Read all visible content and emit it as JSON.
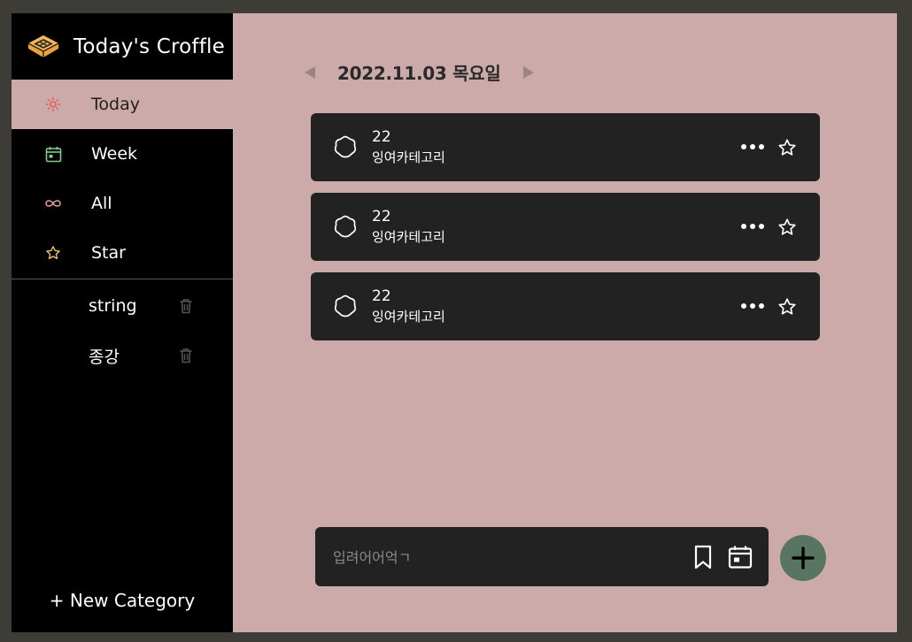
{
  "brand": {
    "title": "Today's Croffle",
    "logo_icon": "croffle-icon"
  },
  "nav": [
    {
      "label": "Today",
      "icon": "sun-icon",
      "color": "#e5534b",
      "active": true
    },
    {
      "label": "Week",
      "icon": "calendar-week-icon",
      "color": "#7ecf8a",
      "active": false
    },
    {
      "label": "All",
      "icon": "infinity-icon",
      "color": "#e9a0a0",
      "active": false
    },
    {
      "label": "Star",
      "icon": "star-icon",
      "color": "#f2c46b",
      "active": false
    }
  ],
  "categories": [
    {
      "label": "string",
      "delete_icon": "trash-icon"
    },
    {
      "label": "종강",
      "delete_icon": "trash-icon"
    }
  ],
  "new_category_label": "+ New Category",
  "date_bar": {
    "date": "2022.11.03 목요일",
    "prev_icon": "triangle-left-icon",
    "next_icon": "triangle-right-icon"
  },
  "todos": [
    {
      "title": "22",
      "category": "잉여카테고리"
    },
    {
      "title": "22",
      "category": "잉여카테고리"
    },
    {
      "title": "22",
      "category": "잉여카테고리"
    }
  ],
  "input": {
    "placeholder": "입려어어억ㄱ",
    "value": ""
  },
  "colors": {
    "background": "#3d3c37",
    "sidebar": "#000000",
    "main": "#ccaaa9",
    "card": "#222222",
    "add_button": "#577562",
    "brand_accent": "#e8a33d"
  }
}
